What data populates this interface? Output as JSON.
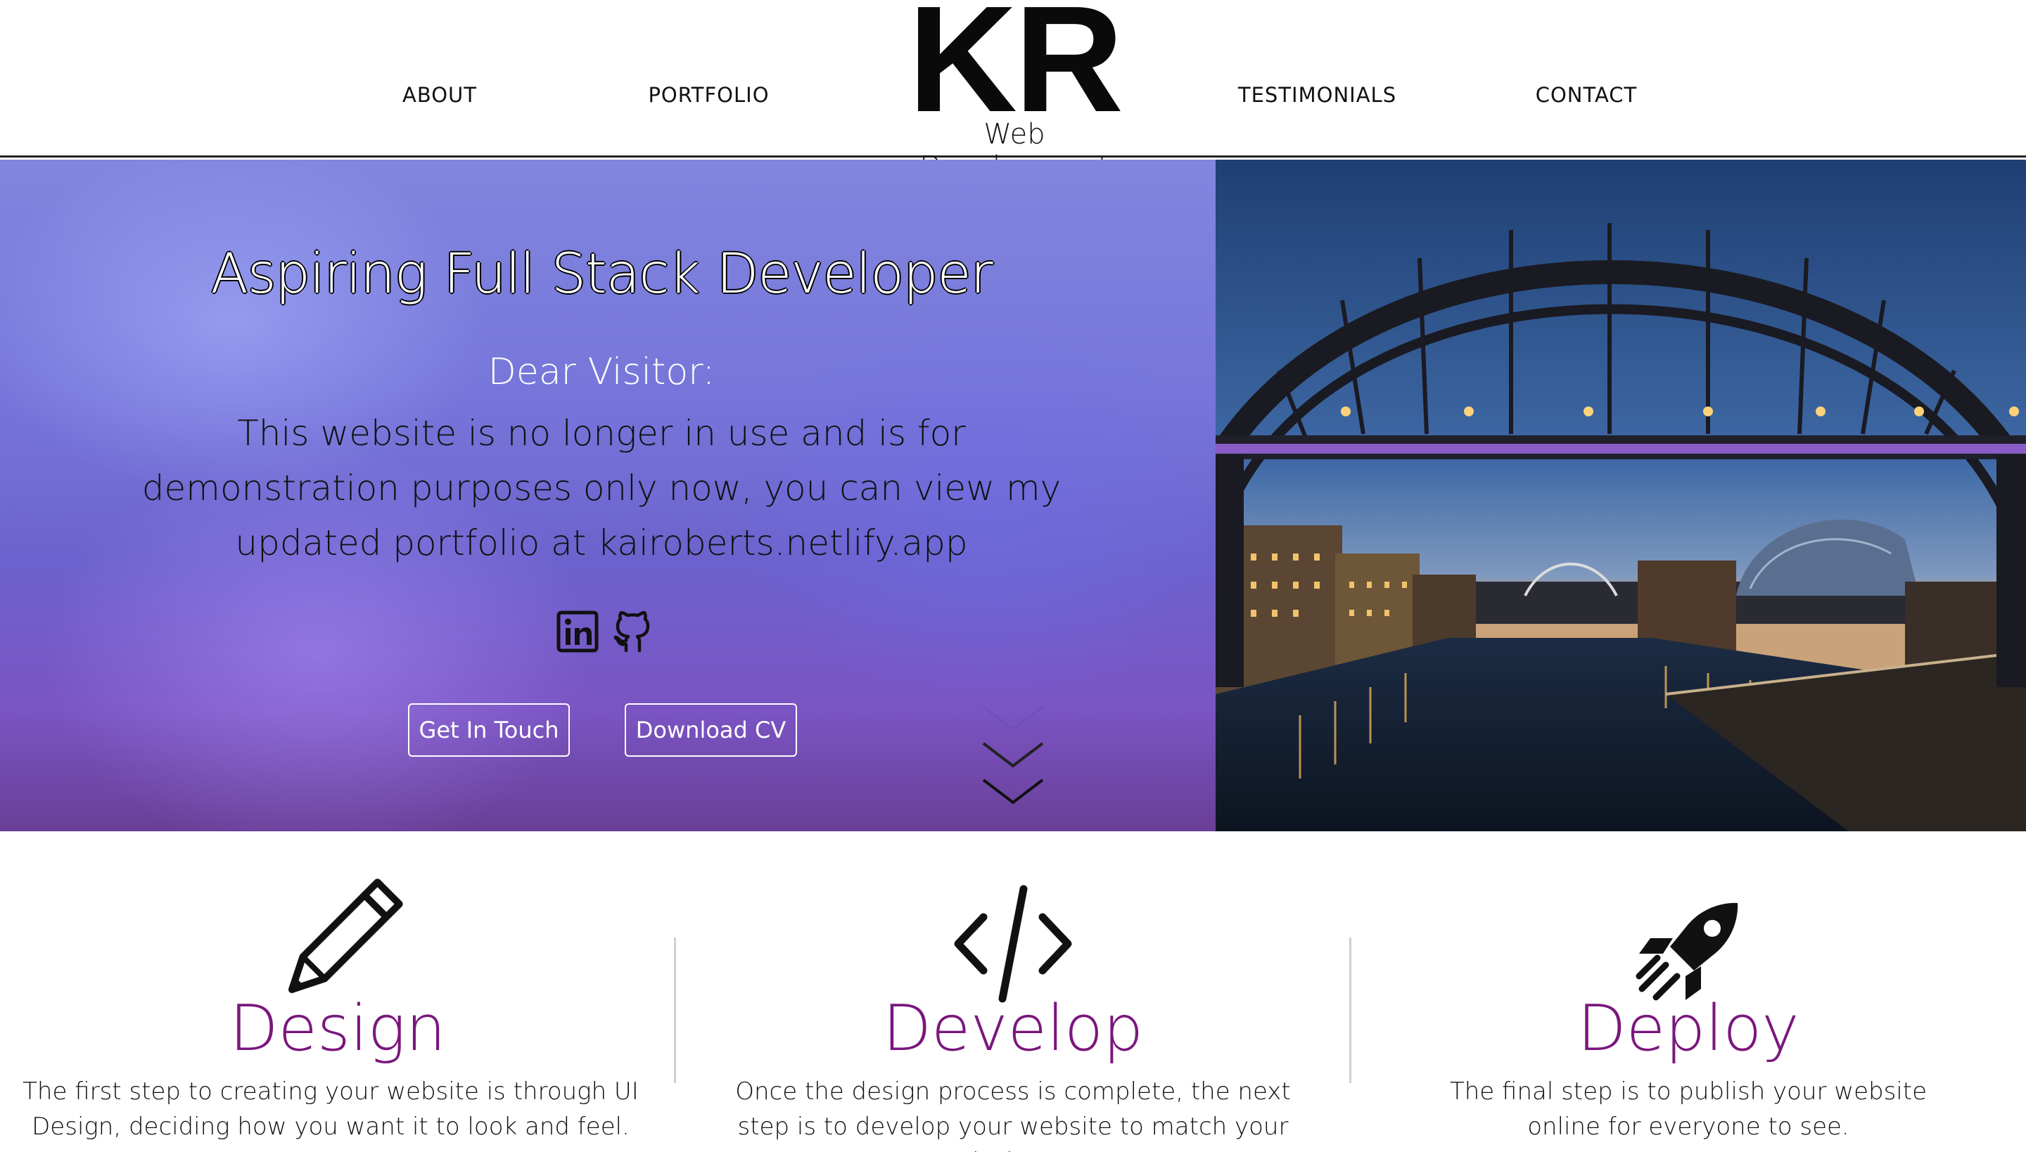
{
  "nav": {
    "about": "ABOUT",
    "portfolio": "PORTFOLIO",
    "testimonials": "TESTIMONIALS",
    "contact": "CONTACT"
  },
  "logo": {
    "initials": "KR",
    "subtitle": "Web Development"
  },
  "hero": {
    "title": "Aspiring Full Stack Developer",
    "greeting": "Dear Visitor:",
    "message": "This website is no longer in use and is for demonstration purposes only now, you can view my updated portfolio at kairoberts.netlify.app",
    "social_icons": [
      "linkedin-icon",
      "github-icon"
    ],
    "buttons": {
      "get_in_touch": "Get In Touch",
      "download_cv": "Download CV"
    },
    "scroll_icon": "chevron-down-icon"
  },
  "services": [
    {
      "icon": "pencil-icon",
      "title": "Design",
      "text": "The first step to creating your website is through UI Design, deciding how you want it to look and feel."
    },
    {
      "icon": "code-icon",
      "title": "Develop",
      "text": "Once the design process is complete, the next step is to develop your website to match your designs."
    },
    {
      "icon": "rocket-icon",
      "title": "Deploy",
      "text": "The final step is to publish your website online for everyone to see."
    }
  ],
  "colors": {
    "accent": "#7a177d",
    "hero_top": "#8186de",
    "hero_bottom": "#6a3f98"
  }
}
